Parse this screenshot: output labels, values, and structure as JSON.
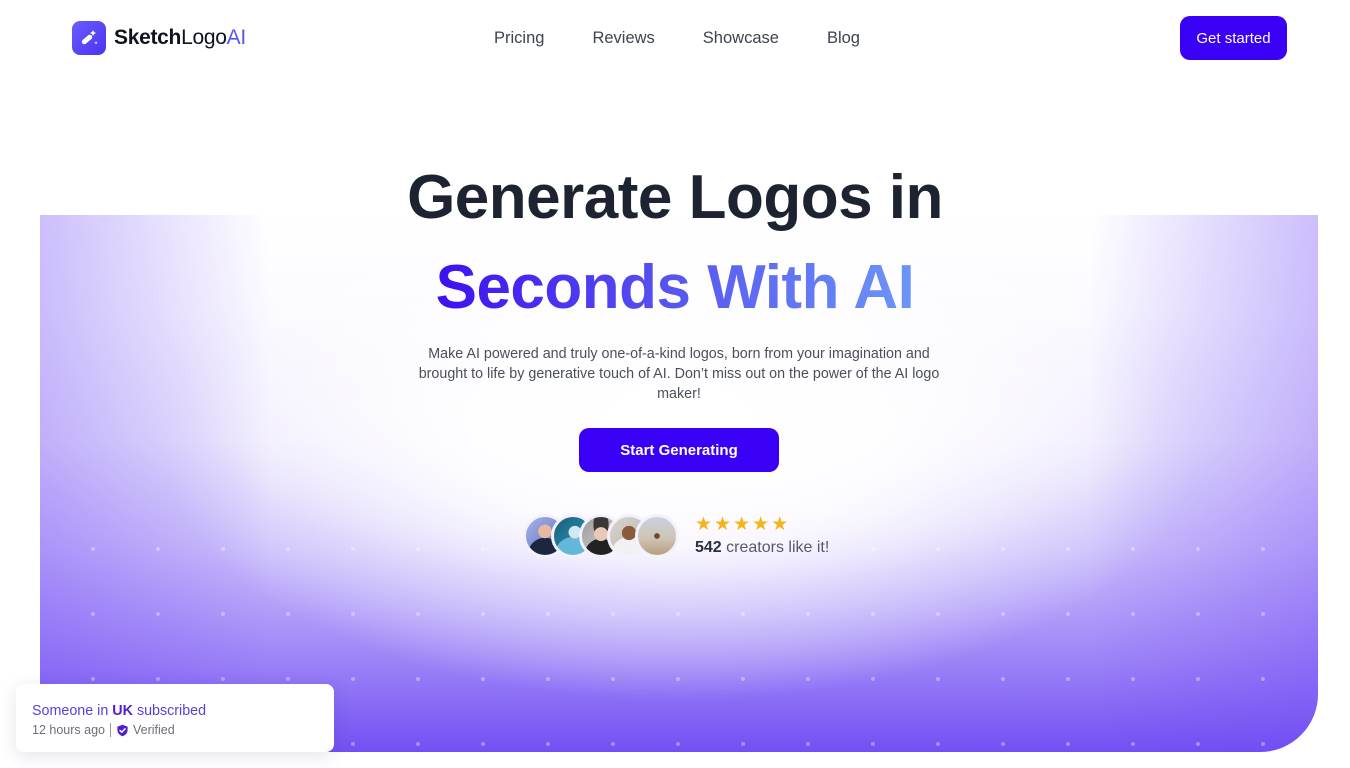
{
  "header": {
    "brand": {
      "part1": "Sketch",
      "part2": "Logo",
      "part3": "AI",
      "icon": "magic-wand-icon"
    },
    "nav": [
      {
        "label": "Pricing"
      },
      {
        "label": "Reviews"
      },
      {
        "label": "Showcase"
      },
      {
        "label": "Blog"
      }
    ],
    "cta_label": "Get started"
  },
  "hero": {
    "title_line1": "Generate Logos in",
    "title_line2": "Seconds With AI",
    "subtitle": "Make AI powered and truly one-of-a-kind logos, born from your imagination and brought to life by generative touch of AI. Don’t miss out on the power of the AI logo maker!",
    "cta_label": "Start Generating",
    "social_proof": {
      "avatars_count": 5,
      "stars": 5,
      "count": "542",
      "text": "creators like it!"
    }
  },
  "toast": {
    "prefix": "Someone in",
    "country": "UK",
    "suffix": "subscribed",
    "time": "12 hours ago",
    "verified_label": "Verified"
  },
  "colors": {
    "accent": "#3a00f5",
    "title": "#1d2330",
    "gradient_start": "#3d10f0",
    "gradient_end": "#6c96f6",
    "star": "#f3b51a"
  }
}
